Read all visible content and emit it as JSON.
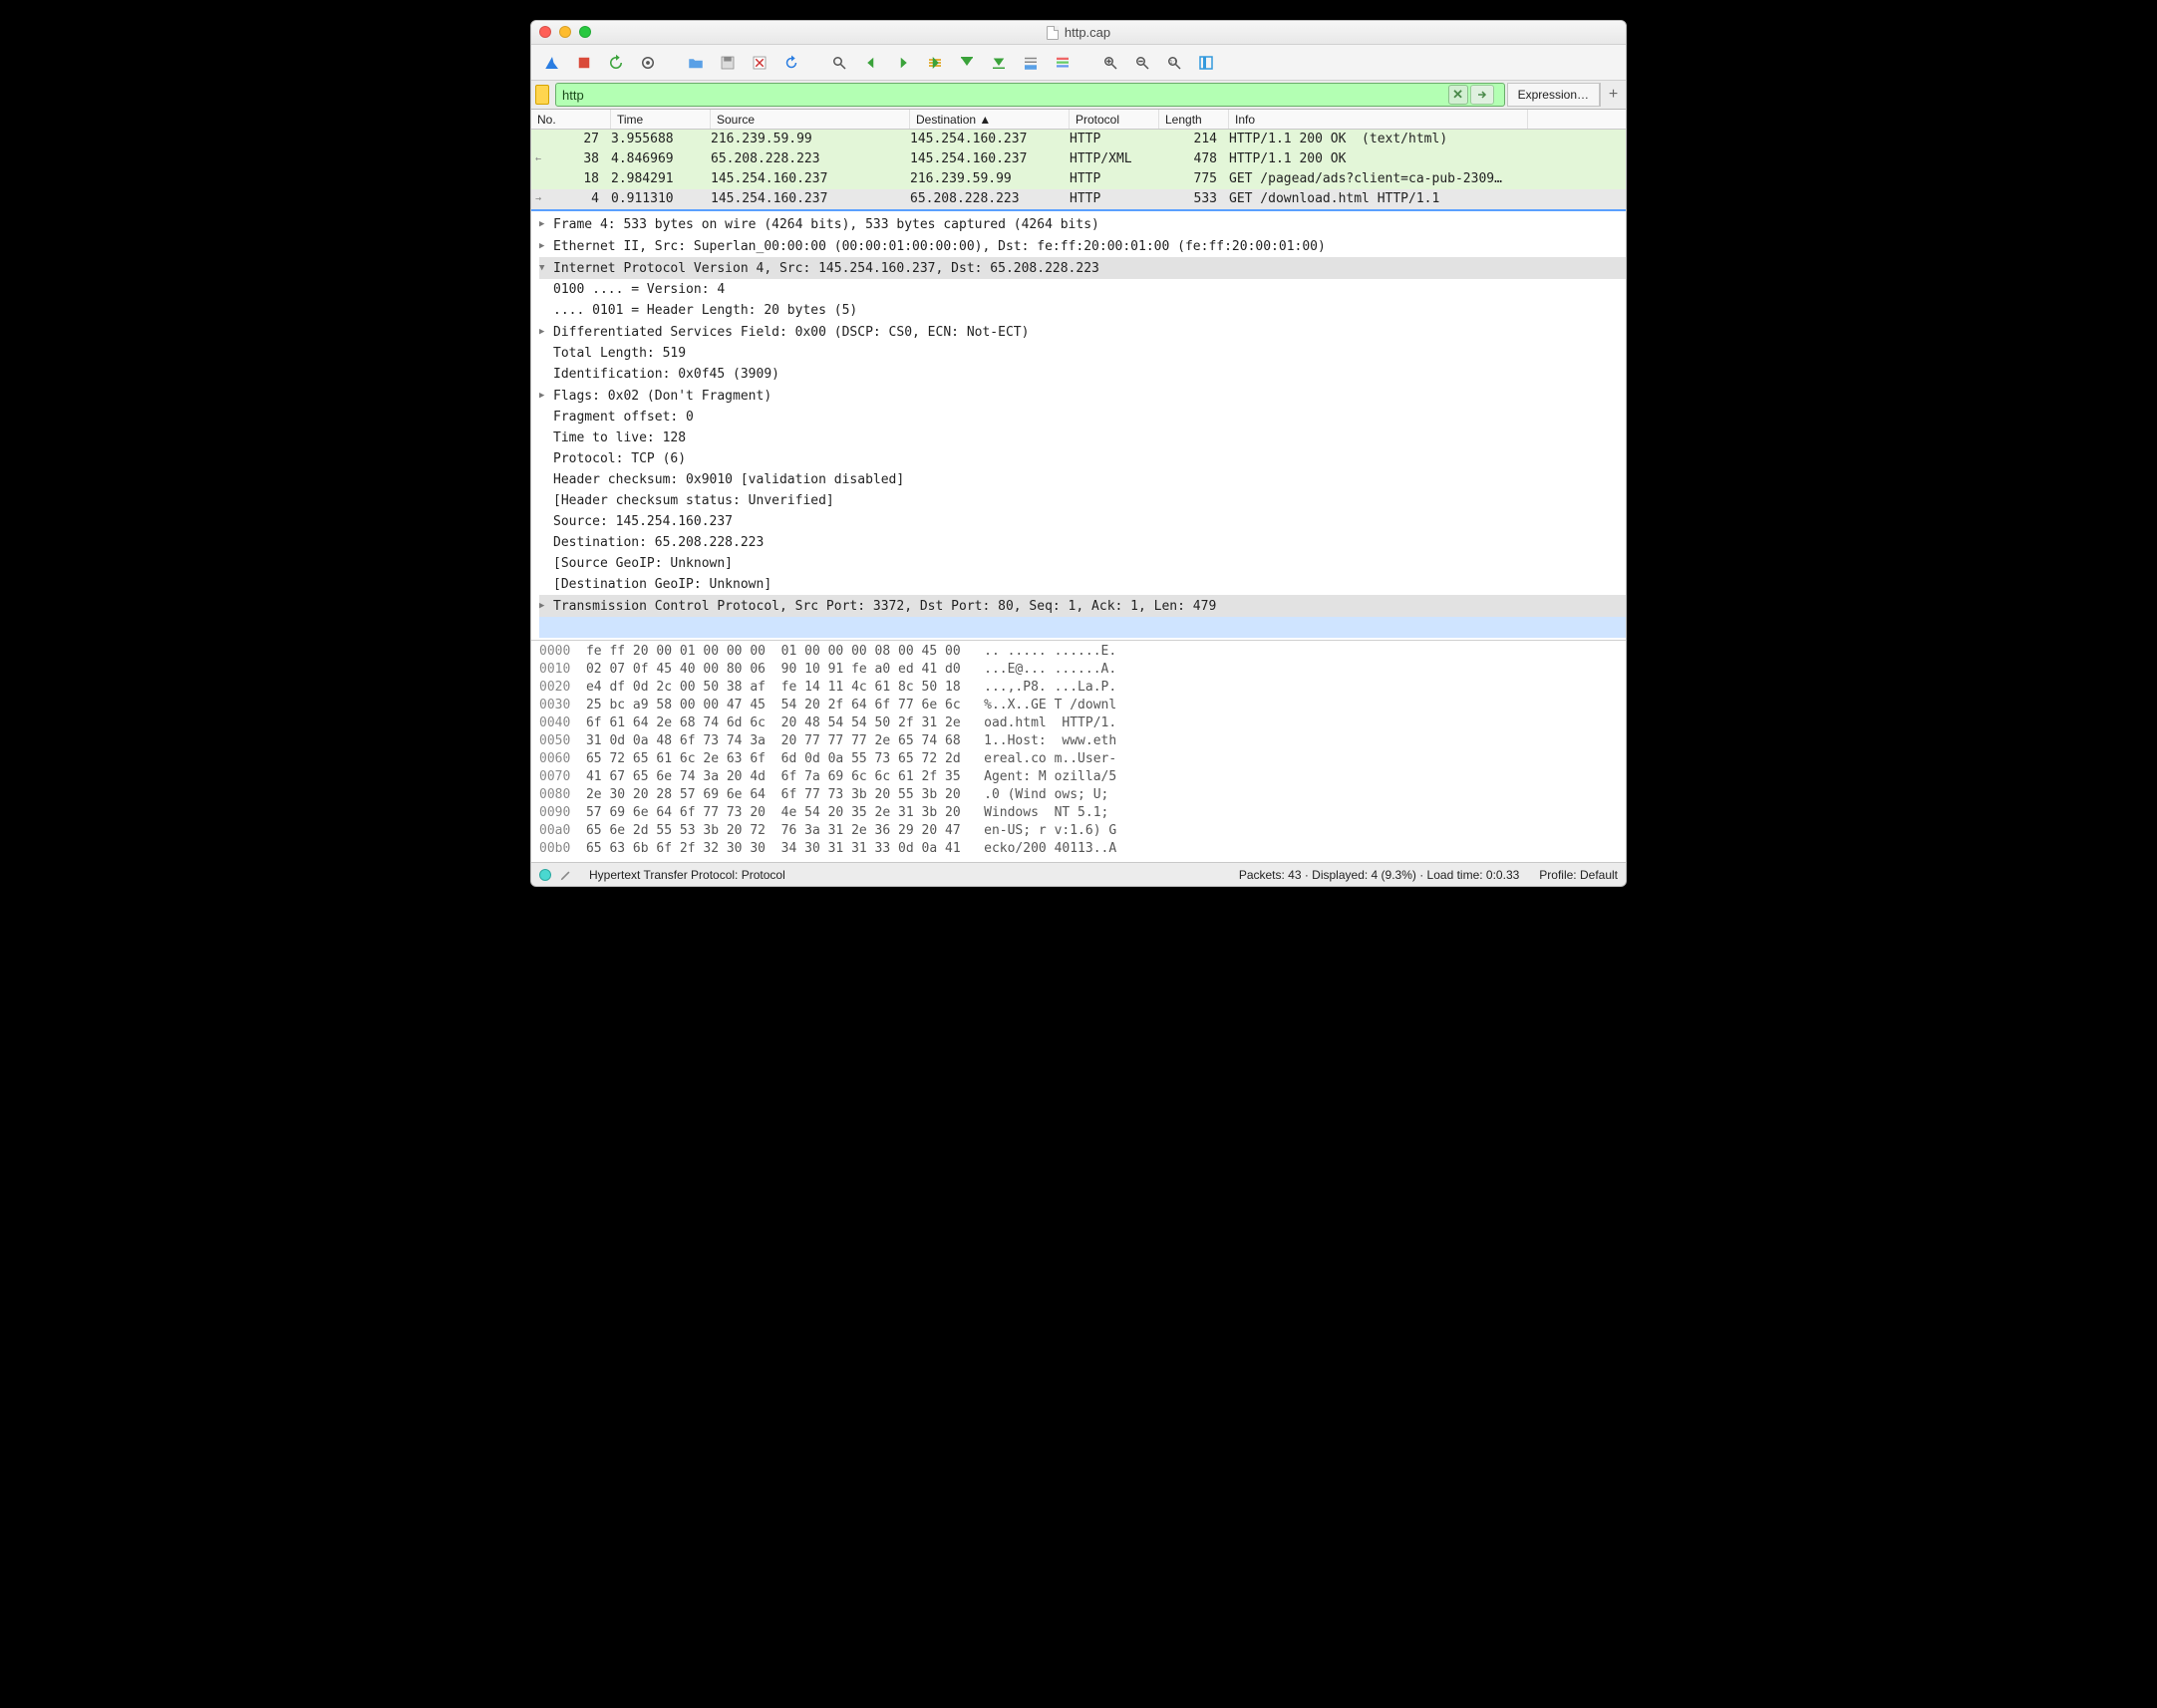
{
  "title": "http.cap",
  "filter": {
    "value": "http",
    "expression_btn": "Expression…",
    "plus": "+"
  },
  "columns": [
    "No.",
    "Time",
    "Source",
    "Destination",
    "Protocol",
    "Length",
    "Info"
  ],
  "packets": [
    {
      "no": "27",
      "time": "3.955688",
      "src": "216.239.59.99",
      "dst": "145.254.160.237",
      "proto": "HTTP",
      "len": "214",
      "info": "HTTP/1.1 200 OK  (text/html)",
      "cls": "green",
      "gut": ""
    },
    {
      "no": "38",
      "time": "4.846969",
      "src": "65.208.228.223",
      "dst": "145.254.160.237",
      "proto": "HTTP/XML",
      "len": "478",
      "info": "HTTP/1.1 200 OK",
      "cls": "green",
      "gut": "←"
    },
    {
      "no": "18",
      "time": "2.984291",
      "src": "145.254.160.237",
      "dst": "216.239.59.99",
      "proto": "HTTP",
      "len": "775",
      "info": "GET /pagead/ads?client=ca-pub-2309…",
      "cls": "green",
      "gut": ""
    },
    {
      "no": "4",
      "time": "0.911310",
      "src": "145.254.160.237",
      "dst": "65.208.228.223",
      "proto": "HTTP",
      "len": "533",
      "info": "GET /download.html HTTP/1.1",
      "cls": "sel",
      "gut": "→"
    }
  ],
  "details": [
    {
      "ind": 0,
      "tri": "r",
      "text": "Frame 4: 533 bytes on wire (4264 bits), 533 bytes captured (4264 bits)",
      "hl": false
    },
    {
      "ind": 0,
      "tri": "r",
      "text": "Ethernet II, Src: Superlan_00:00:00 (00:00:01:00:00:00), Dst: fe:ff:20:00:01:00 (fe:ff:20:00:01:00)",
      "hl": false
    },
    {
      "ind": 0,
      "tri": "d",
      "text": "Internet Protocol Version 4, Src: 145.254.160.237, Dst: 65.208.228.223",
      "hl": true
    },
    {
      "ind": 1,
      "tri": "",
      "text": "0100 .... = Version: 4",
      "hl": false
    },
    {
      "ind": 1,
      "tri": "",
      "text": ".... 0101 = Header Length: 20 bytes (5)",
      "hl": false
    },
    {
      "ind": 1,
      "tri": "r",
      "text": "Differentiated Services Field: 0x00 (DSCP: CS0, ECN: Not-ECT)",
      "hl": false
    },
    {
      "ind": 1,
      "tri": "",
      "text": "Total Length: 519",
      "hl": false
    },
    {
      "ind": 1,
      "tri": "",
      "text": "Identification: 0x0f45 (3909)",
      "hl": false
    },
    {
      "ind": 1,
      "tri": "r",
      "text": "Flags: 0x02 (Don't Fragment)",
      "hl": false
    },
    {
      "ind": 1,
      "tri": "",
      "text": "Fragment offset: 0",
      "hl": false
    },
    {
      "ind": 1,
      "tri": "",
      "text": "Time to live: 128",
      "hl": false
    },
    {
      "ind": 1,
      "tri": "",
      "text": "Protocol: TCP (6)",
      "hl": false
    },
    {
      "ind": 1,
      "tri": "",
      "text": "Header checksum: 0x9010 [validation disabled]",
      "hl": false
    },
    {
      "ind": 1,
      "tri": "",
      "text": "[Header checksum status: Unverified]",
      "hl": false
    },
    {
      "ind": 1,
      "tri": "",
      "text": "Source: 145.254.160.237",
      "hl": false
    },
    {
      "ind": 1,
      "tri": "",
      "text": "Destination: 65.208.228.223",
      "hl": false
    },
    {
      "ind": 1,
      "tri": "",
      "text": "[Source GeoIP: Unknown]",
      "hl": false
    },
    {
      "ind": 1,
      "tri": "",
      "text": "[Destination GeoIP: Unknown]",
      "hl": false
    },
    {
      "ind": 0,
      "tri": "r",
      "text": "Transmission Control Protocol, Src Port: 3372, Dst Port: 80, Seq: 1, Ack: 1, Len: 479",
      "hl": true
    },
    {
      "ind": 0,
      "tri": "",
      "text": "",
      "hl": false,
      "blue": true
    }
  ],
  "hex": [
    {
      "off": "0000",
      "b": "fe ff 20 00 01 00 00 00  01 00 00 00 08 00 45 00",
      "a": ".. ..... ......E."
    },
    {
      "off": "0010",
      "b": "02 07 0f 45 40 00 80 06  90 10 91 fe a0 ed 41 d0",
      "a": "...E@... ......A."
    },
    {
      "off": "0020",
      "b": "e4 df 0d 2c 00 50 38 af  fe 14 11 4c 61 8c 50 18",
      "a": "...,.P8. ...La.P."
    },
    {
      "off": "0030",
      "b": "25 bc a9 58 00 00 47 45  54 20 2f 64 6f 77 6e 6c",
      "a": "%..X..GE T /downl"
    },
    {
      "off": "0040",
      "b": "6f 61 64 2e 68 74 6d 6c  20 48 54 54 50 2f 31 2e",
      "a": "oad.html  HTTP/1."
    },
    {
      "off": "0050",
      "b": "31 0d 0a 48 6f 73 74 3a  20 77 77 77 2e 65 74 68",
      "a": "1..Host:  www.eth"
    },
    {
      "off": "0060",
      "b": "65 72 65 61 6c 2e 63 6f  6d 0d 0a 55 73 65 72 2d",
      "a": "ereal.co m..User-"
    },
    {
      "off": "0070",
      "b": "41 67 65 6e 74 3a 20 4d  6f 7a 69 6c 6c 61 2f 35",
      "a": "Agent: M ozilla/5"
    },
    {
      "off": "0080",
      "b": "2e 30 20 28 57 69 6e 64  6f 77 73 3b 20 55 3b 20",
      "a": ".0 (Wind ows; U; "
    },
    {
      "off": "0090",
      "b": "57 69 6e 64 6f 77 73 20  4e 54 20 35 2e 31 3b 20",
      "a": "Windows  NT 5.1; "
    },
    {
      "off": "00a0",
      "b": "65 6e 2d 55 53 3b 20 72  76 3a 31 2e 36 29 20 47",
      "a": "en-US; r v:1.6) G"
    },
    {
      "off": "00b0",
      "b": "65 63 6b 6f 2f 32 30 30  34 30 31 31 33 0d 0a 41",
      "a": "ecko/200 40113..A"
    }
  ],
  "status": {
    "left": "Hypertext Transfer Protocol: Protocol",
    "right1": "Packets: 43 · Displayed: 4 (9.3%) · Load time: 0:0.33",
    "right2": "Profile: Default"
  },
  "colwidths": {
    "no": 60,
    "time": 100,
    "src": 200,
    "dst": 160,
    "proto": 90,
    "len": 70
  }
}
